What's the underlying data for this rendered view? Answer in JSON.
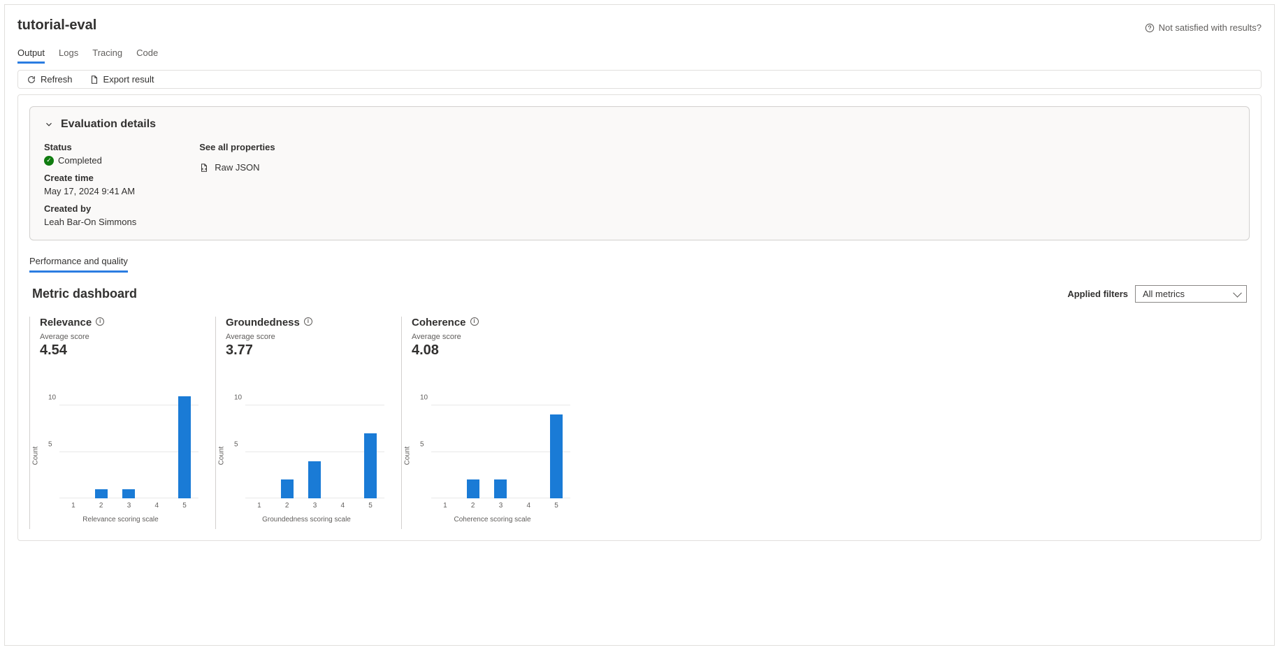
{
  "header": {
    "title": "tutorial-eval",
    "feedback": "Not satisfied with results?"
  },
  "tabs": [
    "Output",
    "Logs",
    "Tracing",
    "Code"
  ],
  "active_tab": 0,
  "toolbar": {
    "refresh": "Refresh",
    "export": "Export result"
  },
  "details": {
    "panel_title": "Evaluation details",
    "status_label": "Status",
    "status_value": "Completed",
    "create_time_label": "Create time",
    "create_time_value": "May 17, 2024 9:41 AM",
    "created_by_label": "Created by",
    "created_by_value": "Leah Bar-On Simmons",
    "see_all_label": "See all properties",
    "raw_json": "Raw JSON"
  },
  "sub_tab": "Performance and quality",
  "dashboard": {
    "title": "Metric dashboard",
    "filters_label": "Applied filters",
    "filters_value": "All metrics"
  },
  "metrics_common": {
    "avg_label": "Average score",
    "y_label": "Count"
  },
  "chart_data": [
    {
      "type": "bar",
      "title": "Relevance",
      "avg": "4.54",
      "xlabel": "Relevance scoring scale",
      "categories": [
        "1",
        "2",
        "3",
        "4",
        "5"
      ],
      "values": [
        0,
        1,
        1,
        0,
        11
      ],
      "y_ticks": [
        5,
        10
      ],
      "y_max": 12.5
    },
    {
      "type": "bar",
      "title": "Groundedness",
      "avg": "3.77",
      "xlabel": "Groundedness scoring scale",
      "categories": [
        "1",
        "2",
        "3",
        "4",
        "5"
      ],
      "values": [
        0,
        2,
        4,
        0,
        7
      ],
      "y_ticks": [
        5,
        10
      ],
      "y_max": 12.5
    },
    {
      "type": "bar",
      "title": "Coherence",
      "avg": "4.08",
      "xlabel": "Coherence scoring scale",
      "categories": [
        "1",
        "2",
        "3",
        "4",
        "5"
      ],
      "values": [
        0,
        2,
        2,
        0,
        9
      ],
      "y_ticks": [
        5,
        10
      ],
      "y_max": 12.5
    }
  ]
}
